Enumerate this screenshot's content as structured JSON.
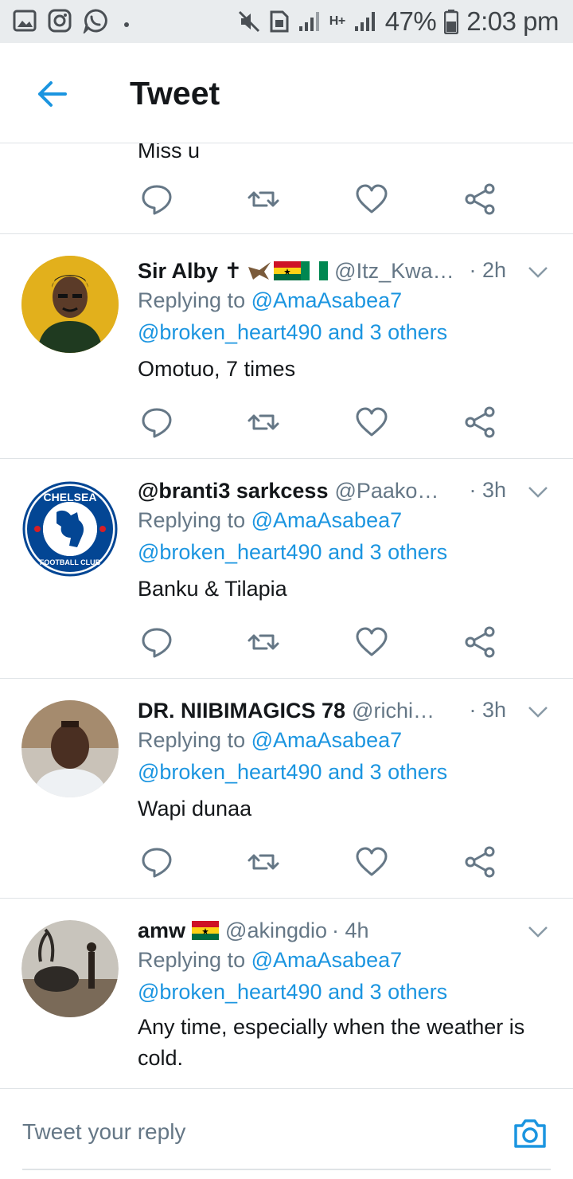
{
  "status_bar": {
    "battery": "47%",
    "time": "2:03 pm",
    "network_label": "H+"
  },
  "header": {
    "title": "Tweet"
  },
  "partial_tweet": {
    "text": "Miss u"
  },
  "tweets": [
    {
      "name": "Sir Alby ✝",
      "handle": "@Itz_Kwa…",
      "time": "· 2h",
      "replying_label": "Replying to",
      "mention_1": "@AmaAsabea7",
      "mention_2": "@broken_heart490 and 3 others",
      "text": "Omotuo, 7 times"
    },
    {
      "name": "@branti3 sarkcess",
      "handle": "@Paako…",
      "time": "· 3h",
      "replying_label": "Replying to",
      "mention_1": "@AmaAsabea7",
      "mention_2": "@broken_heart490 and 3 others",
      "text": "Banku & Tilapia"
    },
    {
      "name": "DR. NIIBIMAGICS 78",
      "handle": "@richi…",
      "time": "· 3h",
      "replying_label": "Replying to",
      "mention_1": "@AmaAsabea7",
      "mention_2": "@broken_heart490 and 3 others",
      "text": "Wapi dunaa"
    },
    {
      "name": "amw",
      "handle": "@akingdio",
      "time": "· 4h",
      "replying_label": "Replying to",
      "mention_1": "@AmaAsabea7",
      "mention_2": "@broken_heart490 and 3 others",
      "text": "Any time, especially when the weather is cold."
    }
  ],
  "reply_bar": {
    "placeholder": "Tweet your reply"
  },
  "colors": {
    "accent": "#1b95e0",
    "muted": "#657786",
    "text": "#14171a",
    "divider": "#dfe3e6"
  },
  "icons": [
    "back-arrow-icon",
    "reply-icon",
    "retweet-icon",
    "like-icon",
    "share-icon",
    "caret-down-icon",
    "camera-icon"
  ]
}
